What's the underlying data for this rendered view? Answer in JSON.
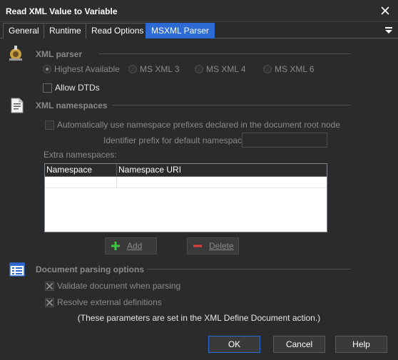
{
  "window": {
    "title": "Read XML Value to Variable"
  },
  "tabs": [
    {
      "label": "General",
      "active": false
    },
    {
      "label": "Runtime",
      "active": false
    },
    {
      "label": "Read Options",
      "active": false
    },
    {
      "label": "MSXML Parser",
      "active": true
    }
  ],
  "xml_parser": {
    "heading": "XML parser",
    "options": [
      {
        "label": "Highest Available",
        "selected": true
      },
      {
        "label": "MS XML 3",
        "selected": false
      },
      {
        "label": "MS XML 4",
        "selected": false
      },
      {
        "label": "MS XML 6",
        "selected": false
      }
    ],
    "allow_dtds": {
      "label": "Allow DTDs",
      "checked": false
    }
  },
  "xml_namespaces": {
    "heading": "XML namespaces",
    "auto_prefix": {
      "label": "Automatically use namespace prefixes declared in the document root node",
      "checked": false
    },
    "identifier_prefix_label": "Identifier prefix for default namespace:",
    "identifier_prefix_value": "",
    "extra_label": "Extra namespaces:",
    "table": {
      "columns": [
        "Namespace Prefix",
        "Namespace URI"
      ],
      "rows": [
        {
          "prefix": "",
          "uri": ""
        }
      ]
    },
    "add_button": "Add",
    "delete_button": "Delete"
  },
  "parsing_options": {
    "heading": "Document parsing options",
    "validate": {
      "label": "Validate document when parsing",
      "checked": true
    },
    "resolve_external": {
      "label": "Resolve external definitions",
      "checked": true
    },
    "note": "(These parameters are set in the XML Define Document action.)"
  },
  "footer": {
    "ok": "OK",
    "cancel": "Cancel",
    "help": "Help"
  },
  "colors": {
    "accent": "#2e6ad3",
    "background": "#2b2b2b",
    "disabled_text": "#8a8a8a",
    "add_green": "#3cc43c",
    "delete_red": "#e04040"
  }
}
